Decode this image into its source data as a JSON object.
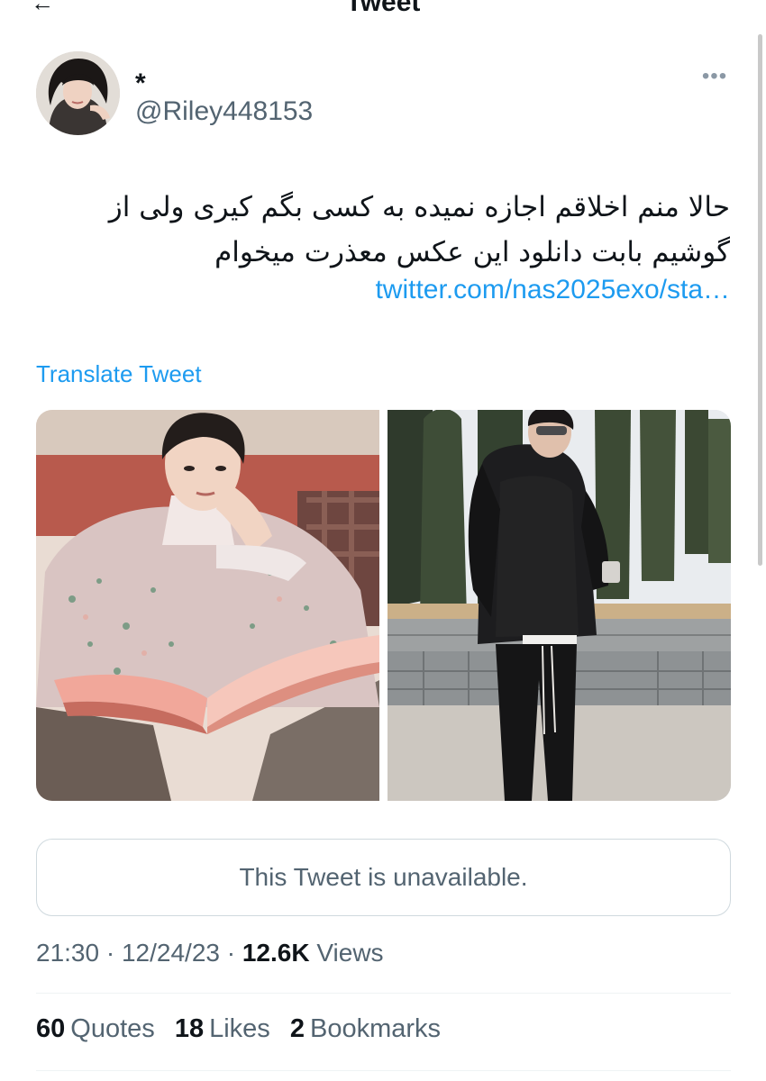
{
  "topbar": {
    "title": "Tweet",
    "back_icon": "arrow-left-icon"
  },
  "author": {
    "display_name": "*",
    "handle": "@Riley448153",
    "avatar_icon": "profile-photo"
  },
  "more_icon": "more-horizontal-icon",
  "tweet": {
    "text_lines": [
      "حالا منم اخلاقم اجازه نمیده به کسی بگم کیری ولی از",
      "گوشیم بابت دانلود این عکس معذرت میخوام"
    ],
    "link": "twitter.com/nas2025exo/sta…",
    "translate_label": "Translate Tweet"
  },
  "media": [
    {
      "icon": "photo-man-reading-book"
    },
    {
      "icon": "photo-man-in-leather-jacket"
    }
  ],
  "quoted": {
    "text": "This Tweet is unavailable."
  },
  "meta": {
    "time": "21:30",
    "date": "12/24/23",
    "separator": "·",
    "views_count": "12.6K",
    "views_label": "Views"
  },
  "stats": [
    {
      "count": "60",
      "label": "Quotes"
    },
    {
      "count": "18",
      "label": "Likes"
    },
    {
      "count": "2",
      "label": "Bookmarks"
    }
  ],
  "colors": {
    "link": "#1d9bf0",
    "secondary_text": "#536471",
    "primary_text": "#0f1419",
    "border": "#cfd9de"
  }
}
